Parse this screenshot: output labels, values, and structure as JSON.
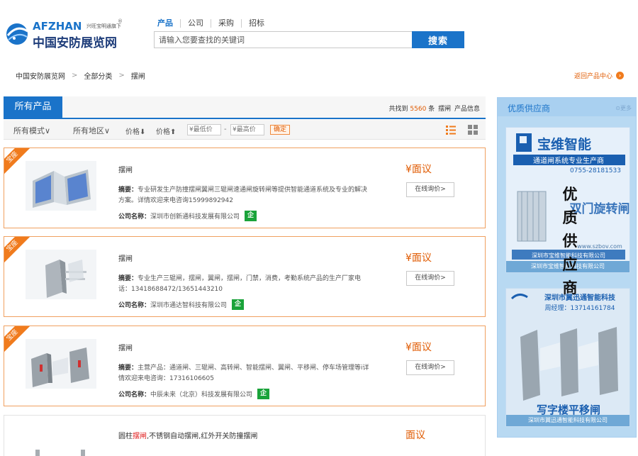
{
  "header": {
    "logo_en": "AFZHAN",
    "logo_en_sub": "兴旺宝明通旗下",
    "logo_reg": "®",
    "logo_cn": "中国安防展览网",
    "search_tabs": [
      "产品",
      "公司",
      "采购",
      "招标"
    ],
    "search_placeholder": "请输入您要查找的关键词",
    "search_button": "搜索"
  },
  "breadcrumb": {
    "items": [
      "中国安防展览网",
      "全部分类",
      "摆闸"
    ],
    "separator": ">",
    "back_link": "返回产品中心",
    "back_arrow": "›"
  },
  "product_panel": {
    "tab_label": "所有产品",
    "found_prefix": "共找到",
    "found_count": "5560",
    "found_unit": "条",
    "found_keyword": "摆闸",
    "found_suffix": "产品信息"
  },
  "filters": {
    "mode": "所有模式∨",
    "region": "所有地区∨",
    "price_desc": "价格⬇",
    "price_asc": "价格⬆",
    "min_price_placeholder": "¥最低价",
    "max_price_placeholder": "¥最高价",
    "dash": "-",
    "confirm": "确定"
  },
  "products": [
    {
      "ribbon": "宝座",
      "title": "摆闸",
      "summary_label": "摘要：",
      "summary": "专业研发生产防撞摆闸翼闸三辊闸速通闸旋转闸等提供智能通道系统及专业的解决方案。详情欢迎来电咨询15999892942",
      "company_label": "公司名称：",
      "company": "深圳市创新通科技发展有限公司",
      "badge": "企",
      "price": "¥面议",
      "inquiry": "在线询价>"
    },
    {
      "ribbon": "宝座",
      "title": "摆闸",
      "summary_label": "摘要：",
      "summary": "专业生产三辊闸，摆闸，翼闸，摆闸，门禁，消费，考勤系统产品的生产厂家电话：13418688472/13651443210",
      "company_label": "公司名称：",
      "company": "深圳市通达智科技有限公司",
      "badge": "企",
      "price": "¥面议",
      "inquiry": "在线询价>"
    },
    {
      "ribbon": "宝座",
      "title": "摆闸",
      "summary_label": "摘要：",
      "summary": "主营产品：通道闸、三辊闸、高转闸、智能摆闸、翼闸、平移闸、停车场管理等i详情欢迎来电咨询：17316106605",
      "company_label": "公司名称：",
      "company": "中辰未来（北京）科技发展有限公司",
      "badge": "企",
      "price": "¥面议",
      "inquiry": "在线询价>"
    },
    {
      "title_pre": "圆柱",
      "title_hl": "摆闸",
      "title_post": ",不锈钢自动摆闸,红外开关防撞摆闸",
      "price": "面议"
    }
  ],
  "sidebar": {
    "title": "优质供应商",
    "more": "⊙更多",
    "vertical_text": "优质供应商",
    "ads": [
      {
        "brand": "宝维智能",
        "slogan": "通道闸系统专业生产商",
        "phone": "0755-28181533",
        "product": "双门旋转闸",
        "website": "www.szbov.com",
        "company_overlay": "深圳市宝维智能科技有限公司",
        "caption": "深圳市宝维智能科技有限公司"
      },
      {
        "brand": "深圳市翼迅通智能科技",
        "manager": "周经理：13714161784",
        "product": "写字楼平移闸",
        "caption": "深圳市翼迅通智能科技有限公司"
      }
    ]
  },
  "colors": {
    "brand_blue": "#1a73c9",
    "accent_orange": "#e05a00",
    "ribbon_orange": "#f07b1d",
    "badge_green": "#1aa33a",
    "sidebar_blue": "#b8d9f2"
  },
  "icons": [
    "globe-logo-icon",
    "chevron-right-icon",
    "list-view-icon",
    "grid-view-icon",
    "turnstile-product-image"
  ]
}
